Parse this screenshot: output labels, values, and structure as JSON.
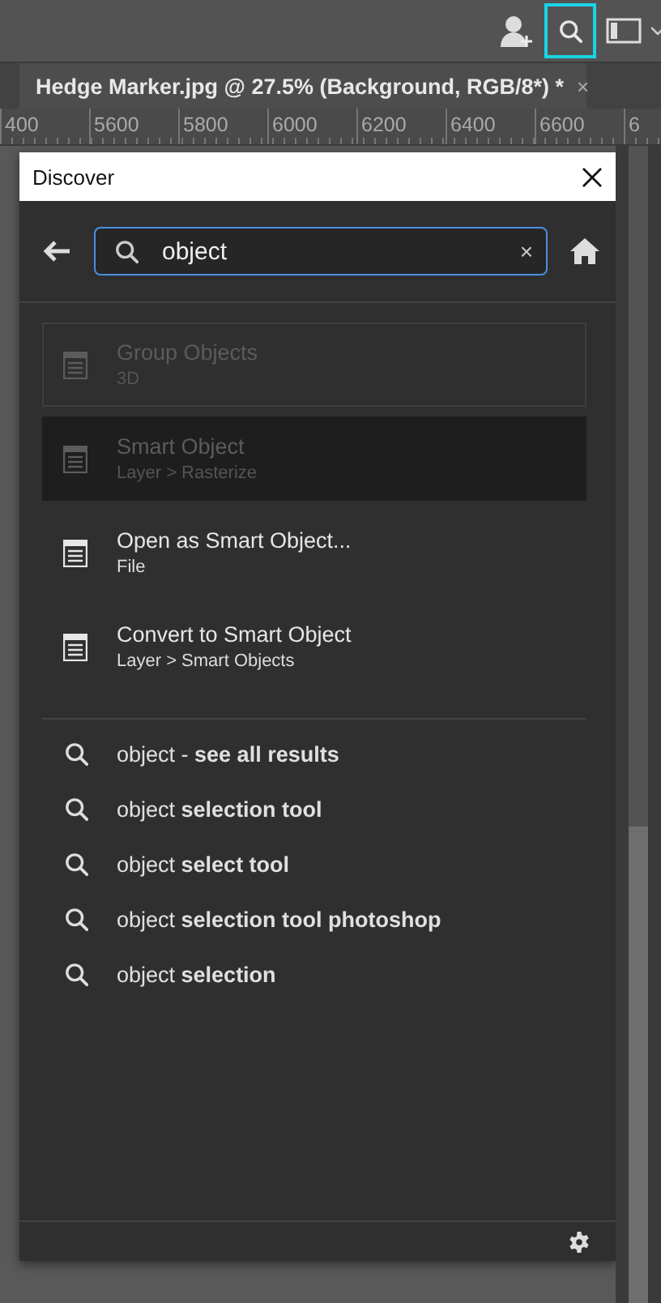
{
  "toolbar": {
    "search_highlighted": true
  },
  "document_tab": {
    "title": "Hedge Marker.jpg @ 27.5% (Background, RGB/8*) *",
    "close": "×"
  },
  "ruler": [
    "400",
    "5600",
    "5800",
    "6000",
    "6200",
    "6400",
    "6600",
    "6"
  ],
  "discover": {
    "title": "Discover",
    "search": {
      "value": "object",
      "clear": "×"
    },
    "results": [
      {
        "title": "Group Objects",
        "path": "3D",
        "disabled": true,
        "focused": true,
        "hovered": false
      },
      {
        "title": "Smart Object",
        "path": "Layer > Rasterize",
        "disabled": true,
        "focused": false,
        "hovered": true
      },
      {
        "title": "Open as Smart Object...",
        "path": "File",
        "disabled": false,
        "focused": false,
        "hovered": false
      },
      {
        "title": "Convert to Smart Object",
        "path": "Layer > Smart Objects",
        "disabled": false,
        "focused": false,
        "hovered": false
      }
    ],
    "suggestions": [
      "object - **see all results**",
      "object **selection tool**",
      "object **select tool**",
      "object **selection tool photoshop**",
      "object **selection**"
    ]
  }
}
